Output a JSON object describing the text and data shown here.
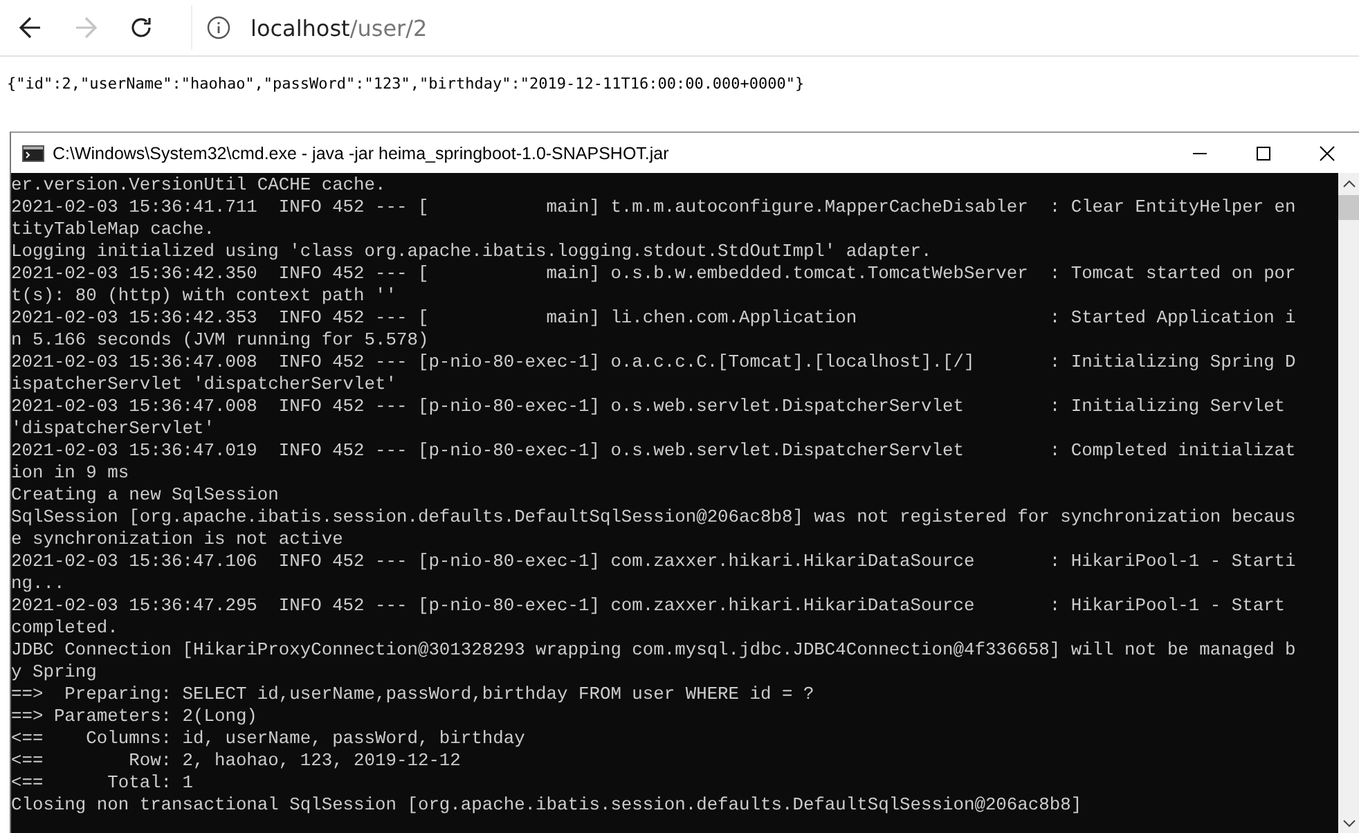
{
  "browser": {
    "back_disabled": false,
    "forward_disabled": true,
    "url_host": "localhost",
    "url_path": "/user/2",
    "body_text": "{\"id\":2,\"userName\":\"haohao\",\"passWord\":\"123\",\"birthday\":\"2019-12-11T16:00:00.000+0000\"}"
  },
  "console": {
    "title": "C:\\Windows\\System32\\cmd.exe - java  -jar heima_springboot-1.0-SNAPSHOT.jar",
    "lines": [
      "er.version.VersionUtil CACHE cache.",
      "2021-02-03 15:36:41.711  INFO 452 --- [           main] t.m.m.autoconfigure.MapperCacheDisabler  : Clear EntityHelper en",
      "tityTableMap cache.",
      "Logging initialized using 'class org.apache.ibatis.logging.stdout.StdOutImpl' adapter.",
      "2021-02-03 15:36:42.350  INFO 452 --- [           main] o.s.b.w.embedded.tomcat.TomcatWebServer  : Tomcat started on por",
      "t(s): 80 (http) with context path ''",
      "2021-02-03 15:36:42.353  INFO 452 --- [           main] li.chen.com.Application                  : Started Application i",
      "n 5.166 seconds (JVM running for 5.578)",
      "2021-02-03 15:36:47.008  INFO 452 --- [p-nio-80-exec-1] o.a.c.c.C.[Tomcat].[localhost].[/]       : Initializing Spring D",
      "ispatcherServlet 'dispatcherServlet'",
      "2021-02-03 15:36:47.008  INFO 452 --- [p-nio-80-exec-1] o.s.web.servlet.DispatcherServlet        : Initializing Servlet",
      "'dispatcherServlet'",
      "2021-02-03 15:36:47.019  INFO 452 --- [p-nio-80-exec-1] o.s.web.servlet.DispatcherServlet        : Completed initializat",
      "ion in 9 ms",
      "Creating a new SqlSession",
      "SqlSession [org.apache.ibatis.session.defaults.DefaultSqlSession@206ac8b8] was not registered for synchronization becaus",
      "e synchronization is not active",
      "2021-02-03 15:36:47.106  INFO 452 --- [p-nio-80-exec-1] com.zaxxer.hikari.HikariDataSource       : HikariPool-1 - Starti",
      "ng...",
      "2021-02-03 15:36:47.295  INFO 452 --- [p-nio-80-exec-1] com.zaxxer.hikari.HikariDataSource       : HikariPool-1 - Start",
      "completed.",
      "JDBC Connection [HikariProxyConnection@301328293 wrapping com.mysql.jdbc.JDBC4Connection@4f336658] will not be managed b",
      "y Spring",
      "==>  Preparing: SELECT id,userName,passWord,birthday FROM user WHERE id = ?",
      "==> Parameters: 2(Long)",
      "<==    Columns: id, userName, passWord, birthday",
      "<==        Row: 2, haohao, 123, 2019-12-12",
      "<==      Total: 1",
      "Closing non transactional SqlSession [org.apache.ibatis.session.defaults.DefaultSqlSession@206ac8b8]"
    ]
  }
}
